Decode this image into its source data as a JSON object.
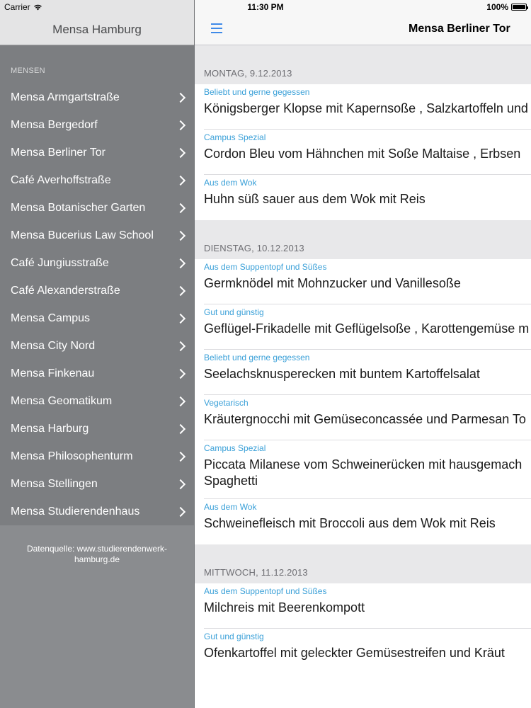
{
  "status_bar": {
    "carrier": "Carrier",
    "time": "11:30 PM",
    "battery": "100%",
    "battery_level": 1.0
  },
  "sidebar": {
    "title": "Mensa Hamburg",
    "section_label": "MENSEN",
    "items": [
      {
        "label": "Mensa Armgartstraße"
      },
      {
        "label": "Mensa Bergedorf"
      },
      {
        "label": "Mensa Berliner Tor"
      },
      {
        "label": "Café Averhoffstraße"
      },
      {
        "label": "Mensa Botanischer Garten"
      },
      {
        "label": "Mensa Bucerius Law School"
      },
      {
        "label": "Café Jungiusstraße"
      },
      {
        "label": "Café Alexanderstraße"
      },
      {
        "label": "Mensa Campus"
      },
      {
        "label": "Mensa City Nord"
      },
      {
        "label": "Mensa Finkenau"
      },
      {
        "label": "Mensa Geomatikum"
      },
      {
        "label": "Mensa Harburg"
      },
      {
        "label": "Mensa Philosophenturm"
      },
      {
        "label": "Mensa Stellingen"
      },
      {
        "label": "Mensa Studierendenhaus"
      }
    ],
    "footer": "Datenquelle: www.studierendenwerk-hamburg.de"
  },
  "main": {
    "title": "Mensa Berliner Tor",
    "days": [
      {
        "label": "MONTAG, 9.12.2013",
        "meals": [
          {
            "category": "Beliebt und gerne gegessen",
            "name": "Königsberger Klopse mit Kapernsoße , Salzkartoffeln und"
          },
          {
            "category": "Campus Spezial",
            "name": "Cordon Bleu vom Hähnchen mit Soße Maltaise , Erbsen"
          },
          {
            "category": "Aus dem Wok",
            "name": "Huhn süß sauer aus dem Wok mit Reis"
          }
        ]
      },
      {
        "label": "DIENSTAG, 10.12.2013",
        "meals": [
          {
            "category": "Aus dem Suppentopf und Süßes",
            "name": "Germknödel mit Mohnzucker und Vanillesoße"
          },
          {
            "category": "Gut und günstig",
            "name": "Geflügel-Frikadelle mit Geflügelsoße , Karottengemüse m"
          },
          {
            "category": "Beliebt und gerne gegessen",
            "name": "Seelachsknusperecken mit buntem Kartoffelsalat"
          },
          {
            "category": "Vegetarisch",
            "name": "Kräutergnocchi mit Gemüseconcassée und Parmesan To"
          },
          {
            "category": "Campus Spezial",
            "name": "Piccata Milanese vom Schweinerücken mit hausgemach",
            "name2": "Spaghetti"
          },
          {
            "category": "Aus dem Wok",
            "name": "Schweinefleisch mit Broccoli aus dem Wok mit Reis"
          }
        ]
      },
      {
        "label": "MITTWOCH, 11.12.2013",
        "meals": [
          {
            "category": "Aus dem Suppentopf und Süßes",
            "name": "Milchreis mit Beerenkompott"
          },
          {
            "category": "Gut und günstig",
            "name": "Ofenkartoffel mit geleckter Gemüsestreifen und Kräut"
          }
        ]
      }
    ]
  },
  "colors": {
    "accent": "#3f8ae8",
    "category": "#3aa0d8",
    "sidebar_bg": "#7c7e81",
    "section_bg": "#e8e8ea"
  }
}
